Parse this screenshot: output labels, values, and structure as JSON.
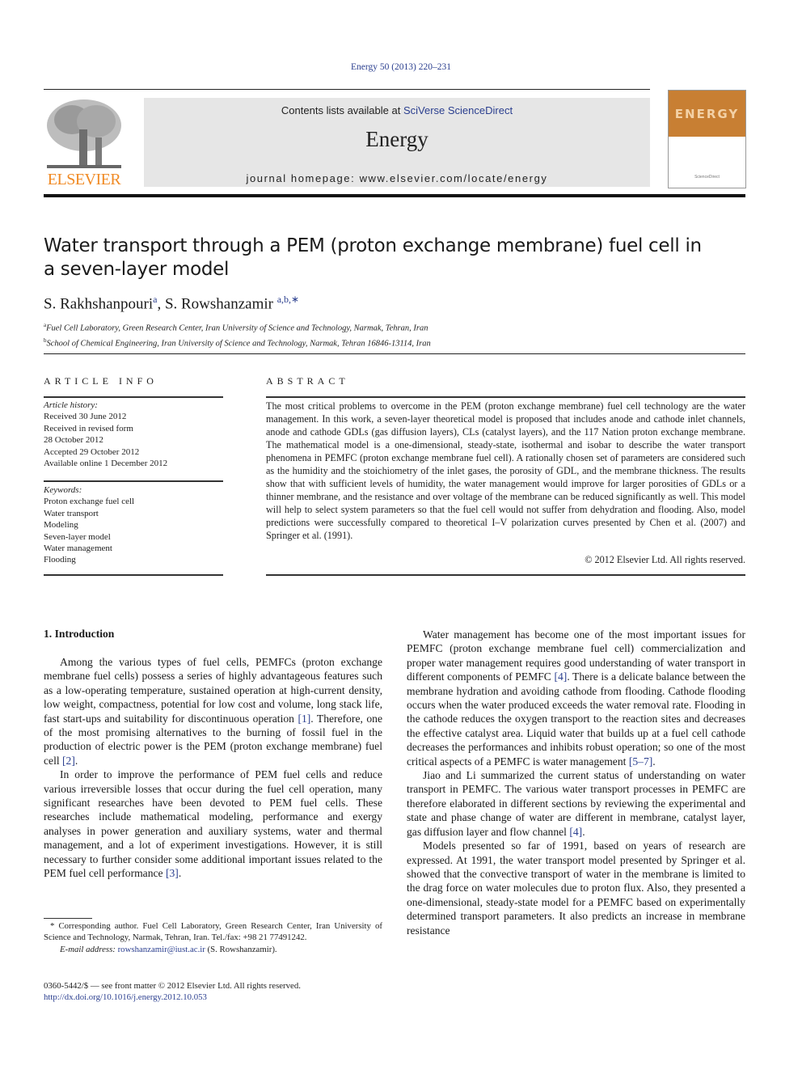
{
  "header": {
    "journal_ref": "Energy 50 (2013) 220–231",
    "contents_prefix": "Contents lists available at ",
    "contents_link": "SciVerse ScienceDirect",
    "journal_name": "Energy",
    "homepage_prefix": "journal homepage: ",
    "homepage_url": "www.elsevier.com/locate/energy",
    "publisher_logo_text": "ELSEVIER",
    "cover_title": "ENERGY",
    "cover_colors": {
      "band": "#c87f33",
      "logo_text": "#f08a24"
    }
  },
  "article": {
    "title": "Water transport through a PEM (proton exchange membrane) fuel cell in a seven-layer model",
    "authors": [
      {
        "name": "S. Rakhshanpouri",
        "sup": "a"
      },
      {
        "name": "S. Rowshanzamir",
        "sup": "a,b,∗"
      }
    ],
    "affiliations": [
      {
        "mark": "a",
        "text": "Fuel Cell Laboratory, Green Research Center, Iran University of Science and Technology, Narmak, Tehran, Iran"
      },
      {
        "mark": "b",
        "text": "School of Chemical Engineering, Iran University of Science and Technology, Narmak, Tehran 16846-13114, Iran"
      }
    ]
  },
  "article_info": {
    "heading": "ARTICLE INFO",
    "history_label": "Article history:",
    "history": [
      "Received 30 June 2012",
      "Received in revised form",
      "28 October 2012",
      "Accepted 29 October 2012",
      "Available online 1 December 2012"
    ],
    "keywords_label": "Keywords:",
    "keywords": [
      "Proton exchange fuel cell",
      "Water transport",
      "Modeling",
      "Seven-layer model",
      "Water management",
      "Flooding"
    ]
  },
  "abstract": {
    "heading": "ABSTRACT",
    "text": "The most critical problems to overcome in the PEM (proton exchange membrane) fuel cell technology are the water management. In this work, a seven-layer theoretical model is proposed that includes anode and cathode inlet channels, anode and cathode GDLs (gas diffusion layers), CLs (catalyst layers), and the 117 Nation proton exchange membrane. The mathematical model is a one-dimensional, steady-state, isothermal and isobar to describe the water transport phenomena in PEMFC (proton exchange membrane fuel cell). A rationally chosen set of parameters are considered such as the humidity and the stoichiometry of the inlet gases, the porosity of GDL, and the membrane thickness. The results show that with sufficient levels of humidity, the water management would improve for larger porosities of GDLs or a thinner membrane, and the resistance and over voltage of the membrane can be reduced significantly as well. This model will help to select system parameters so that the fuel cell would not suffer from dehydration and flooding. Also, model predictions were successfully compared to theoretical I–V polarization curves presented by Chen et al. (2007) and Springer et al. (1991).",
    "copyright": "© 2012 Elsevier Ltd. All rights reserved."
  },
  "body": {
    "intro_heading": "1.  Introduction",
    "left_paragraphs": [
      {
        "text": "Among the various types of fuel cells, PEMFCs (proton exchange membrane fuel cells) possess a series of highly advantageous features such as a low-operating temperature, sustained operation at high-current density, low weight, compactness, potential for low cost and volume, long stack life, fast start-ups and suitability for discontinuous operation ",
        "cite1": "[1]",
        "mid": ". Therefore, one of the most promising alternatives to the burning of fossil fuel in the production of electric power is the PEM (proton exchange membrane) fuel cell ",
        "cite2": "[2]",
        "end": "."
      },
      {
        "text": "In order to improve the performance of PEM fuel cells and reduce various irreversible losses that occur during the fuel cell operation, many significant researches have been devoted to PEM fuel cells. These researches include mathematical modeling, performance and exergy analyses in power generation and auxiliary systems, water and thermal management, and a lot of experiment investigations. However, it is still necessary to further consider some additional important issues related to the PEM fuel cell performance ",
        "cite1": "[3]",
        "end": "."
      }
    ],
    "right_paragraphs": [
      {
        "text": "Water management has become one of the most important issues for PEMFC (proton exchange membrane fuel cell) commercialization and proper water management requires good understanding of water transport in different components of PEMFC ",
        "cite1": "[4]",
        "mid": ". There is a delicate balance between the membrane hydration and avoiding cathode from flooding. Cathode flooding occurs when the water produced exceeds the water removal rate. Flooding in the cathode reduces the oxygen transport to the reaction sites and decreases the effective catalyst area. Liquid water that builds up at a fuel cell cathode decreases the performances and inhibits robust operation; so one of the most critical aspects of a PEMFC is water management ",
        "cite2": "[5–7]",
        "end": "."
      },
      {
        "text": "Jiao and Li summarized the current status of understanding on water transport in PEMFC. The various water transport processes in PEMFC are therefore elaborated in different sections by reviewing the experimental and state and phase change of water are different in membrane, catalyst layer, gas diffusion layer and flow channel ",
        "cite1": "[4]",
        "end": "."
      },
      {
        "text": "Models presented so far of 1991, based on years of research are expressed. At 1991, the water transport model presented by Springer et al. showed that the convective transport of water in the membrane is limited to the drag force on water molecules due to proton flux. Also, they presented a one-dimensional, steady-state model for a PEMFC based on experimentally determined transport parameters. It also predicts an increase in membrane resistance"
      }
    ]
  },
  "footnotes": {
    "corresponding": "* Corresponding author. Fuel Cell Laboratory, Green Research Center, Iran University of Science and Technology, Narmak, Tehran, Iran. Tel./fax: +98 21 77491242.",
    "email_label": "E-mail address: ",
    "email": "rowshanzamir@iust.ac.ir",
    "email_suffix": " (S. Rowshanzamir).",
    "front_matter": "0360-5442/$ — see front matter © 2012 Elsevier Ltd. All rights reserved.",
    "doi": "http://dx.doi.org/10.1016/j.energy.2012.10.053"
  }
}
